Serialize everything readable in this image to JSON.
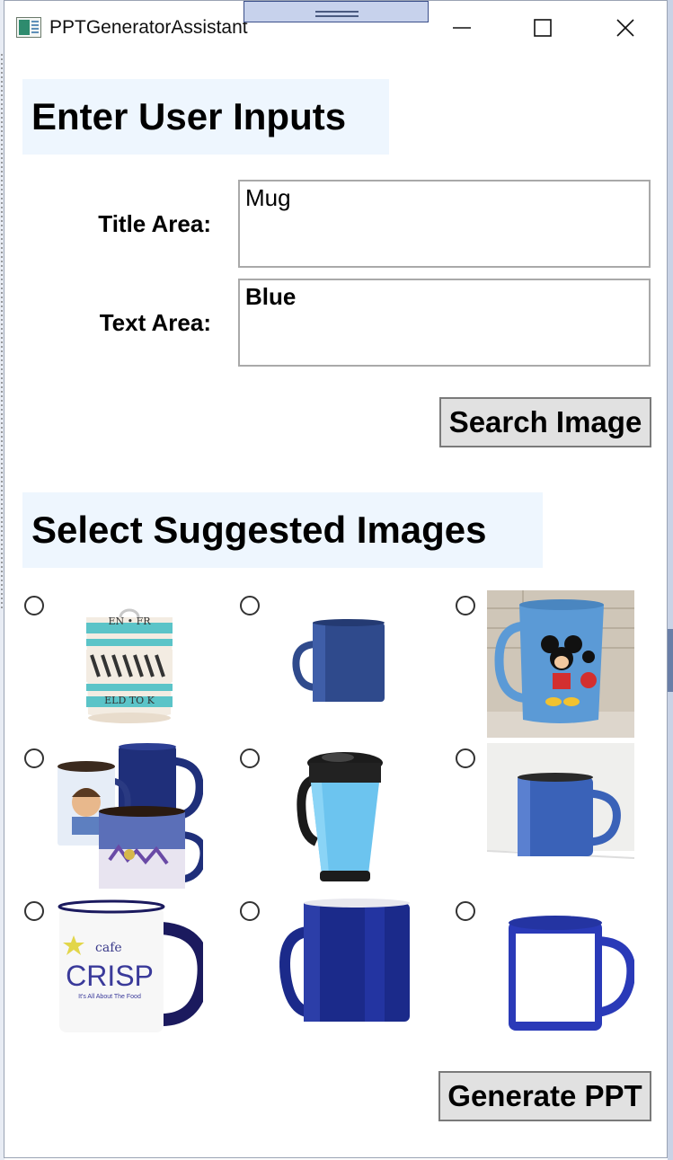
{
  "window": {
    "title": "PPTGeneratorAssistant"
  },
  "inputs_section": {
    "header": "Enter User Inputs",
    "title_label": "Title Area:",
    "title_value": "Mug",
    "text_label": "Text Area:",
    "text_value": "Blue",
    "search_button": "Search Image"
  },
  "images_section": {
    "header": "Select Suggested Images",
    "images": [
      {
        "name": "striped-mug-image",
        "selected": false
      },
      {
        "name": "small-navy-mug-image",
        "selected": false
      },
      {
        "name": "mickey-mouse-mug-image",
        "selected": false
      },
      {
        "name": "photo-magic-mugs-image",
        "selected": false
      },
      {
        "name": "travel-tumbler-image",
        "selected": false
      },
      {
        "name": "enamel-blue-mug-image",
        "selected": false
      },
      {
        "name": "cafe-crisp-mug-image",
        "selected": false
      },
      {
        "name": "navy-mug-image",
        "selected": false
      },
      {
        "name": "white-panel-blue-mug-image",
        "selected": false
      }
    ],
    "image_texts": {
      "striped_mug_band": "EN • FR",
      "striped_mug_bottom": "ELD TO K",
      "cafe_crisp_small": "cafe",
      "cafe_crisp_big": "CRISP",
      "cafe_crisp_tagline": "It's All About The Food"
    },
    "generate_button": "Generate PPT"
  },
  "colors": {
    "header_bg": "#eef6fe",
    "button_bg": "#e1e1e1",
    "mug_navy": "#1f2f7a",
    "mug_blue": "#3a5aa8"
  }
}
